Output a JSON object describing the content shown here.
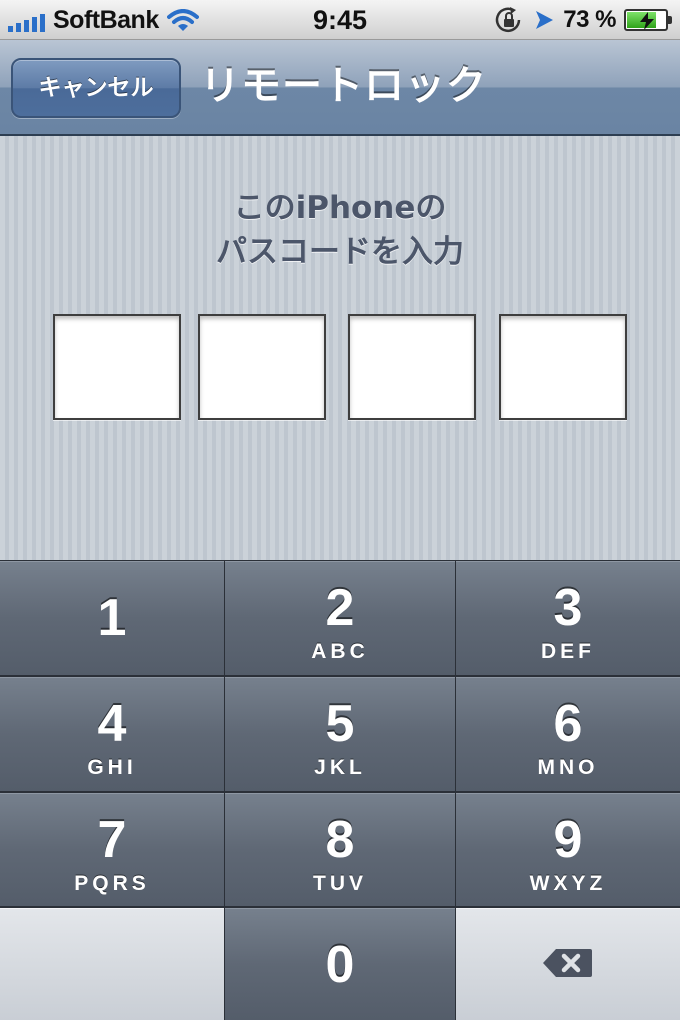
{
  "status_bar": {
    "carrier": "SoftBank",
    "time": "9:45",
    "battery_percent": "73 %",
    "battery_level": 0.73,
    "signal_bars": 5,
    "icons": [
      "signal-bars-icon",
      "wifi-icon",
      "rotation-lock-icon",
      "location-arrow-icon",
      "battery-charging-icon"
    ]
  },
  "nav": {
    "cancel_label": "キャンセル",
    "title": "リモートロック"
  },
  "passcode": {
    "prompt_line1": "このiPhoneの",
    "prompt_line2": "パスコードを入力",
    "digit_count": 4
  },
  "keypad": {
    "keys": [
      {
        "digit": "1",
        "letters": ""
      },
      {
        "digit": "2",
        "letters": "ABC"
      },
      {
        "digit": "3",
        "letters": "DEF"
      },
      {
        "digit": "4",
        "letters": "GHI"
      },
      {
        "digit": "5",
        "letters": "JKL"
      },
      {
        "digit": "6",
        "letters": "MNO"
      },
      {
        "digit": "7",
        "letters": "PQRS"
      },
      {
        "digit": "8",
        "letters": "TUV"
      },
      {
        "digit": "9",
        "letters": "WXYZ"
      },
      {
        "digit": "0",
        "letters": ""
      }
    ],
    "delete_icon": "backspace-icon",
    "colors": {
      "key_dark": "#5f6875",
      "key_light": "#d5d9de"
    }
  }
}
